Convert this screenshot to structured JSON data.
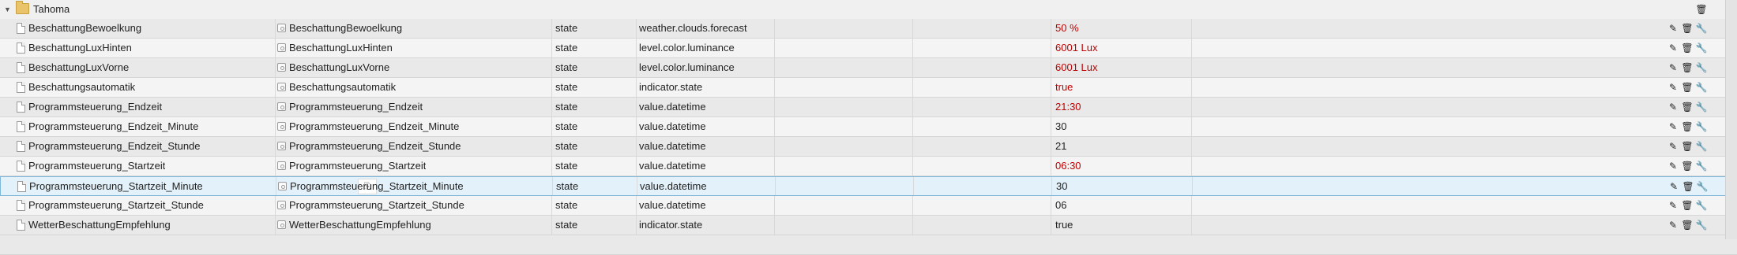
{
  "folder": {
    "name": "Tahoma",
    "delete_icon": "trash-icon"
  },
  "rows": [
    {
      "id": "BeschattungBewoelkung",
      "name": "BeschattungBewoelkung",
      "type": "state",
      "role": "weather.clouds.forecast",
      "value": "50 %",
      "value_color": "red"
    },
    {
      "id": "BeschattungLuxHinten",
      "name": "BeschattungLuxHinten",
      "type": "state",
      "role": "level.color.luminance",
      "value": "6001 Lux",
      "value_color": "red"
    },
    {
      "id": "BeschattungLuxVorne",
      "name": "BeschattungLuxVorne",
      "type": "state",
      "role": "level.color.luminance",
      "value": "6001 Lux",
      "value_color": "red"
    },
    {
      "id": "Beschattungsautomatik",
      "name": "Beschattungsautomatik",
      "type": "state",
      "role": "indicator.state",
      "value": "true",
      "value_color": "red"
    },
    {
      "id": "Programmsteuerung_Endzeit",
      "name": "Programmsteuerung_Endzeit",
      "type": "state",
      "role": "value.datetime",
      "value": "21:30",
      "value_color": "red"
    },
    {
      "id": "Programmsteuerung_Endzeit_Minute",
      "name": "Programmsteuerung_Endzeit_Minute",
      "type": "state",
      "role": "value.datetime",
      "value": "30",
      "value_color": "normal"
    },
    {
      "id": "Programmsteuerung_Endzeit_Stunde",
      "name": "Programmsteuerung_Endzeit_Stunde",
      "type": "state",
      "role": "value.datetime",
      "value": "21",
      "value_color": "normal"
    },
    {
      "id": "Programmsteuerung_Startzeit",
      "name": "Programmsteuerung_Startzeit",
      "type": "state",
      "role": "value.datetime",
      "value": "06:30",
      "value_color": "red"
    },
    {
      "id": "Programmsteuerung_Startzeit_Minute",
      "name": "Programmsteuerung_Startzeit_Minute",
      "type": "state",
      "role": "value.datetime",
      "value": "30",
      "value_color": "normal",
      "selected": true
    },
    {
      "id": "Programmsteuerung_Startzeit_Stunde",
      "name": "Programmsteuerung_Startzeit_Stunde",
      "type": "state",
      "role": "value.datetime",
      "value": "06",
      "value_color": "normal"
    },
    {
      "id": "WetterBeschattungEmpfehlung",
      "name": "WetterBeschattungEmpfehlung",
      "type": "state",
      "role": "indicator.state",
      "value": "true",
      "value_color": "normal"
    }
  ],
  "action_icons": [
    "edit-icon",
    "trash-icon",
    "wrench-icon"
  ],
  "colors": {
    "red_value": "#c00000",
    "selected_bg": "#e3f1fa",
    "selected_border": "#7fb6da"
  }
}
